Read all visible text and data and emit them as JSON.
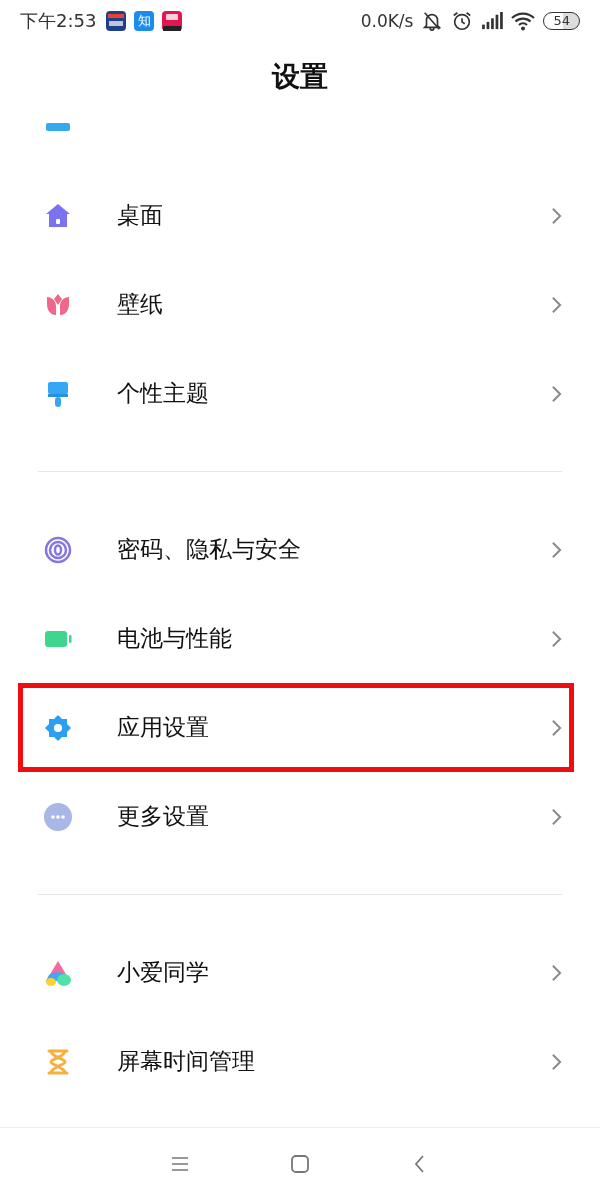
{
  "status_bar": {
    "time": "下午2:53",
    "apps": [
      {
        "kind": "news"
      },
      {
        "kind": "zhihu",
        "label": "知"
      },
      {
        "kind": "tmall"
      }
    ],
    "speed": "0.0K/s",
    "battery": "54"
  },
  "header": {
    "title": "设置"
  },
  "sections": [
    {
      "items": [
        {
          "kind": "bar",
          "highlighted": false
        },
        {
          "kind": "home",
          "label": "桌面",
          "highlighted": false
        },
        {
          "kind": "tulip",
          "label": "壁纸",
          "highlighted": false
        },
        {
          "kind": "brush",
          "label": "个性主题",
          "highlighted": false
        }
      ]
    },
    {
      "items": [
        {
          "kind": "fingerprint",
          "label": "密码、隐私与安全",
          "highlighted": false
        },
        {
          "kind": "battery",
          "label": "电池与性能",
          "highlighted": false
        },
        {
          "kind": "gear",
          "label": "应用设置",
          "highlighted": true
        },
        {
          "kind": "more",
          "label": "更多设置",
          "highlighted": false
        }
      ]
    },
    {
      "items": [
        {
          "kind": "assistant",
          "label": "小爱同学",
          "highlighted": false
        },
        {
          "kind": "hourglass",
          "label": "屏幕时间管理",
          "highlighted": false
        }
      ]
    }
  ],
  "nav_bar": {
    "buttons": [
      {
        "kind": "menu"
      },
      {
        "kind": "home"
      },
      {
        "kind": "back"
      }
    ]
  }
}
